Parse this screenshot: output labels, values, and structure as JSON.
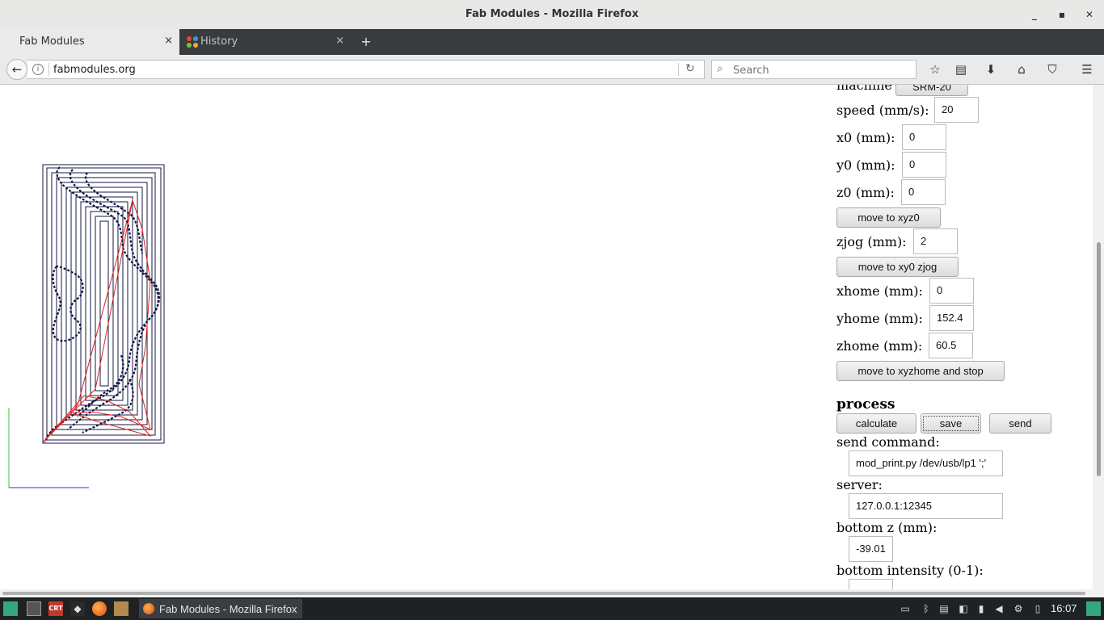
{
  "window": {
    "title": "Fab Modules - Mozilla Firefox"
  },
  "tabs": [
    {
      "label": "Fab Modules",
      "close": "×"
    },
    {
      "label": "History",
      "close": "×"
    }
  ],
  "new_tab": "+",
  "nav": {
    "url": "fabmodules.org",
    "search_placeholder": "Search"
  },
  "form": {
    "machine_label": "machine",
    "machine_value": "SRM-20",
    "speed_label": "speed (mm/s):",
    "speed": "20",
    "x0_label": "x0 (mm):",
    "x0": "0",
    "y0_label": "y0 (mm):",
    "y0": "0",
    "z0_label": "z0 (mm):",
    "z0": "0",
    "move_xyz0": "move to xyz0",
    "zjog_label": "zjog (mm):",
    "zjog": "2",
    "move_xy0_zjog": "move to xy0 zjog",
    "xhome_label": "xhome (mm):",
    "xhome": "0",
    "yhome_label": "yhome (mm):",
    "yhome": "152.4",
    "zhome_label": "zhome (mm):",
    "zhome": "60.5",
    "move_xyzhome": "move to xyzhome and stop",
    "process_heading": "process",
    "calculate": "calculate",
    "save": "save",
    "send": "send",
    "send_command_label": "send command:",
    "send_command": "mod_print.py /dev/usb/lp1 ';'",
    "server_label": "server:",
    "server": "127.0.0.1:12345",
    "bottom_z_label": "bottom z (mm):",
    "bottom_z": "-39.01",
    "bottom_intensity_label": "bottom intensity (0-1):"
  },
  "taskbar": {
    "task_label": "Fab Modules - Mozilla Firefox",
    "clock": "16:07"
  },
  "colors": {
    "path": "#151845",
    "travel": "#e0201e",
    "axis_y": "#40c040",
    "axis_x": "#3030d0"
  }
}
